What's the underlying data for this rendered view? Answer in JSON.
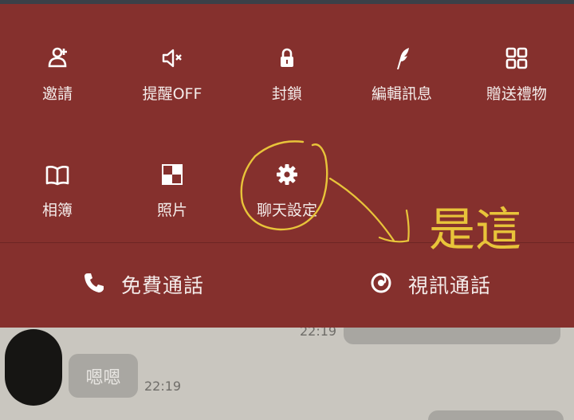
{
  "menu": {
    "row1": [
      {
        "label": "邀請",
        "icon": "invite-icon"
      },
      {
        "label": "提醒OFF",
        "icon": "mute-icon"
      },
      {
        "label": "封鎖",
        "icon": "lock-icon"
      },
      {
        "label": "編輯訊息",
        "icon": "feather-icon"
      },
      {
        "label": "贈送禮物",
        "icon": "grid-icon"
      }
    ],
    "row2": [
      {
        "label": "相簿",
        "icon": "book-icon"
      },
      {
        "label": "照片",
        "icon": "photo-icon"
      },
      {
        "label": "聊天設定",
        "icon": "gear-icon"
      }
    ],
    "calls": {
      "free_call": "免費通話",
      "video_call": "視訊通話"
    }
  },
  "chat": {
    "messages": [
      {
        "side": "right",
        "time": "22:19"
      },
      {
        "side": "left",
        "text": "嗯嗯",
        "time": "22:19"
      }
    ]
  },
  "annotation": {
    "handwritten_note": "是這"
  },
  "colors": {
    "menu_bg": "#85302d",
    "annotation": "#e8c43a"
  }
}
